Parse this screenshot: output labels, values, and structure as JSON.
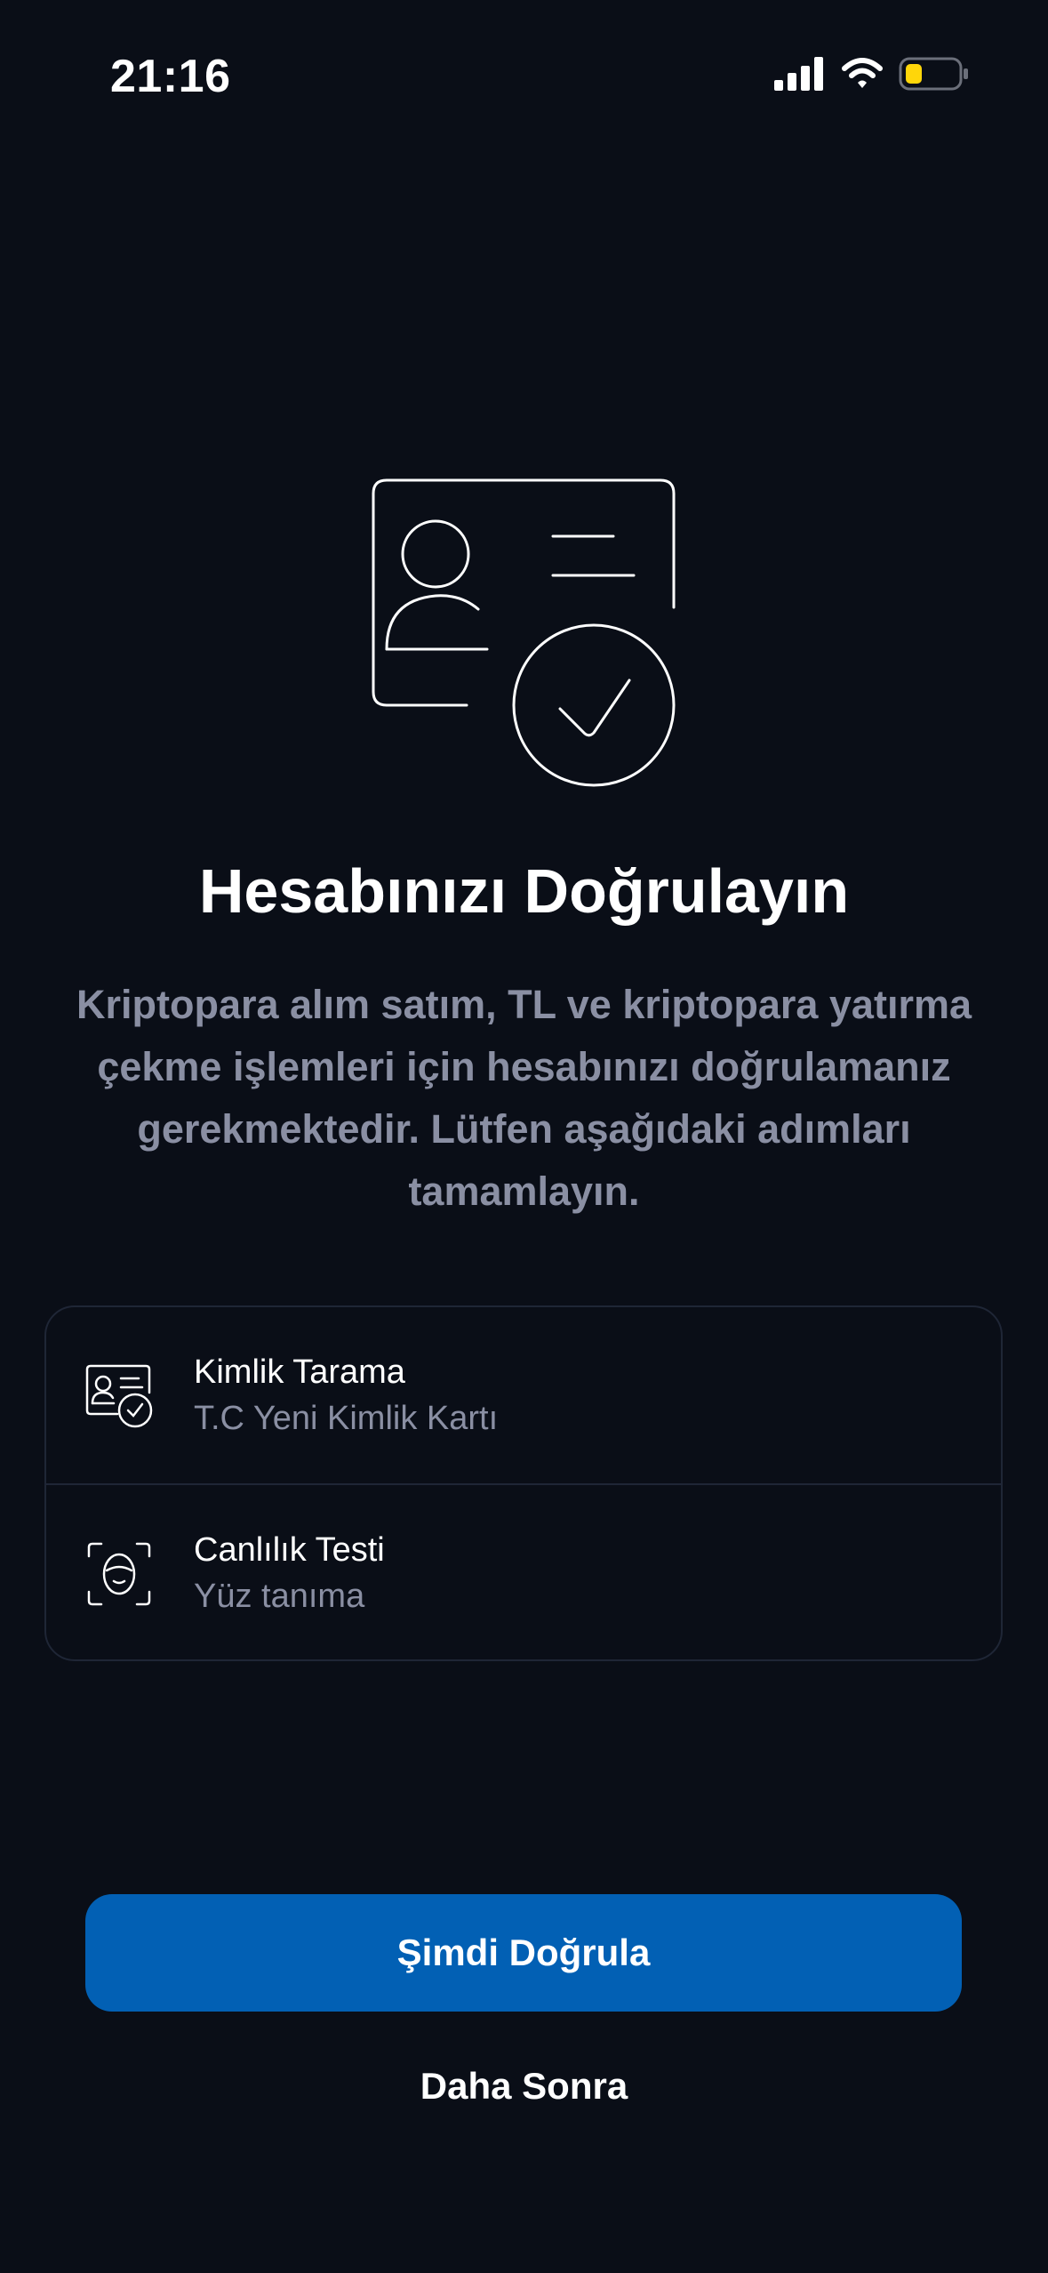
{
  "status_bar": {
    "time": "21:16",
    "icons": [
      "signal-icon",
      "wifi-icon",
      "battery-icon"
    ],
    "battery_color": "#ffd60a"
  },
  "hero": {
    "icon": "id-card-verified-icon"
  },
  "title": "Hesabınızı Doğrulayın",
  "description": "Kriptopara alım satım, TL ve kriptopara yatırma çekme işlemleri için hesabınızı doğrulamanız gerekmektedir. Lütfen aşağıdaki adımları tamamlayın.",
  "steps": [
    {
      "icon": "id-scan-icon",
      "title": "Kimlik Tarama",
      "subtitle": "T.C Yeni Kimlik Kartı"
    },
    {
      "icon": "face-scan-icon",
      "title": "Canlılık Testi",
      "subtitle": "Yüz tanıma"
    }
  ],
  "actions": {
    "primary_label": "Şimdi Doğrula",
    "secondary_label": "Daha Sonra"
  },
  "colors": {
    "background": "#0a0e17",
    "primary": "#0260b4",
    "muted_text": "#8a8fa3",
    "border": "#1f2636"
  }
}
